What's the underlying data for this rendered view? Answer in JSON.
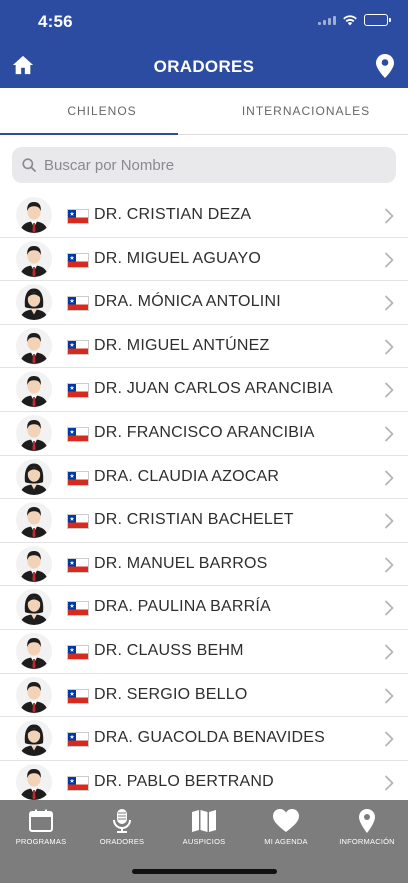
{
  "status": {
    "time": "4:56"
  },
  "header": {
    "title": "ORADORES",
    "home_icon": "home-icon",
    "location_icon": "location-pin-icon"
  },
  "tabs": [
    {
      "label": "CHILENOS",
      "active": true
    },
    {
      "label": "INTERNACIONALES",
      "active": false
    }
  ],
  "search": {
    "placeholder": "Buscar por Nombre",
    "value": ""
  },
  "speakers": [
    {
      "name": "DR. CRISTIAN DEZA",
      "gender": "male",
      "flag": "chile-flag-icon"
    },
    {
      "name": "DR. MIGUEL AGUAYO",
      "gender": "male",
      "flag": "chile-flag-icon"
    },
    {
      "name": "DRA. MÓNICA ANTOLINI",
      "gender": "female",
      "flag": "chile-flag-icon"
    },
    {
      "name": "DR. MIGUEL ANTÚNEZ",
      "gender": "male",
      "flag": "chile-flag-icon"
    },
    {
      "name": "DR. JUAN CARLOS ARANCIBIA",
      "gender": "male",
      "flag": "chile-flag-icon"
    },
    {
      "name": "DR. FRANCISCO ARANCIBIA",
      "gender": "male",
      "flag": "chile-flag-icon"
    },
    {
      "name": "DRA. CLAUDIA AZOCAR",
      "gender": "female",
      "flag": "chile-flag-icon"
    },
    {
      "name": "DR. CRISTIAN BACHELET",
      "gender": "male",
      "flag": "chile-flag-icon"
    },
    {
      "name": "DR. MANUEL BARROS",
      "gender": "male",
      "flag": "chile-flag-icon"
    },
    {
      "name": "DRA. PAULINA BARRÍA",
      "gender": "female",
      "flag": "chile-flag-icon"
    },
    {
      "name": "DR. CLAUSS BEHM",
      "gender": "male",
      "flag": "chile-flag-icon"
    },
    {
      "name": "DR. SERGIO BELLO",
      "gender": "male",
      "flag": "chile-flag-icon"
    },
    {
      "name": "DRA. GUACOLDA BENAVIDES",
      "gender": "female",
      "flag": "chile-flag-icon"
    },
    {
      "name": "DR. PABLO BERTRAND",
      "gender": "male",
      "flag": "chile-flag-icon"
    }
  ],
  "tabbar": [
    {
      "label": "PROGRAMAS",
      "icon": "calendar-icon"
    },
    {
      "label": "ORADORES",
      "icon": "microphone-icon"
    },
    {
      "label": "AUSPICIOS",
      "icon": "map-icon"
    },
    {
      "label": "MI AGENDA",
      "icon": "heart-icon"
    },
    {
      "label": "INFORMACIÓN",
      "icon": "location-pin-icon"
    }
  ],
  "colors": {
    "brand": "#2b4ca0",
    "tabbar": "#7d7d7d",
    "chile_red": "#d52b1e",
    "chile_blue": "#0039a6"
  }
}
